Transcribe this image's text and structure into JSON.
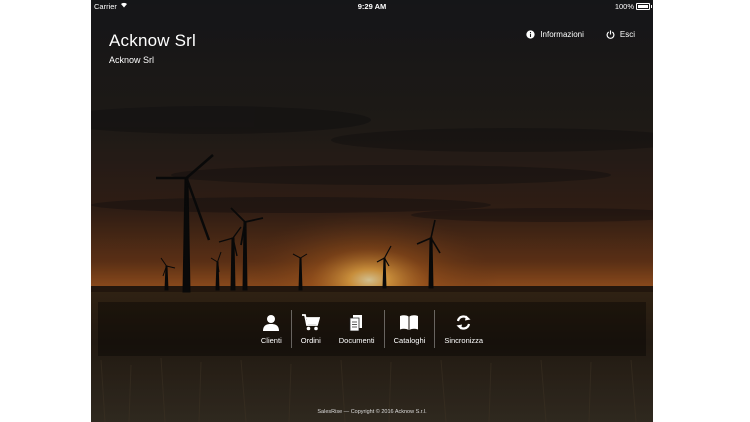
{
  "status_bar": {
    "carrier": "Carrier",
    "time": "9:29 AM",
    "battery": "100%"
  },
  "header": {
    "company_name": "Acknow Srl",
    "company_subtitle": "Acknow Srl",
    "info_label": "Informazioni",
    "exit_label": "Esci"
  },
  "toolbar": {
    "items": [
      {
        "label": "Clienti",
        "icon": "person-icon"
      },
      {
        "label": "Ordini",
        "icon": "cart-icon"
      },
      {
        "label": "Documenti",
        "icon": "document-icon"
      },
      {
        "label": "Cataloghi",
        "icon": "book-icon"
      },
      {
        "label": "Sincronizza",
        "icon": "sync-icon"
      }
    ]
  },
  "footer": {
    "text": "SalesRise — Copyright © 2016 Acknow S.r.l."
  },
  "colors": {
    "sky_top": "#191a1c",
    "sunset": "#8a4a1f",
    "sun": "#ffd27a",
    "text": "#ffffff"
  }
}
